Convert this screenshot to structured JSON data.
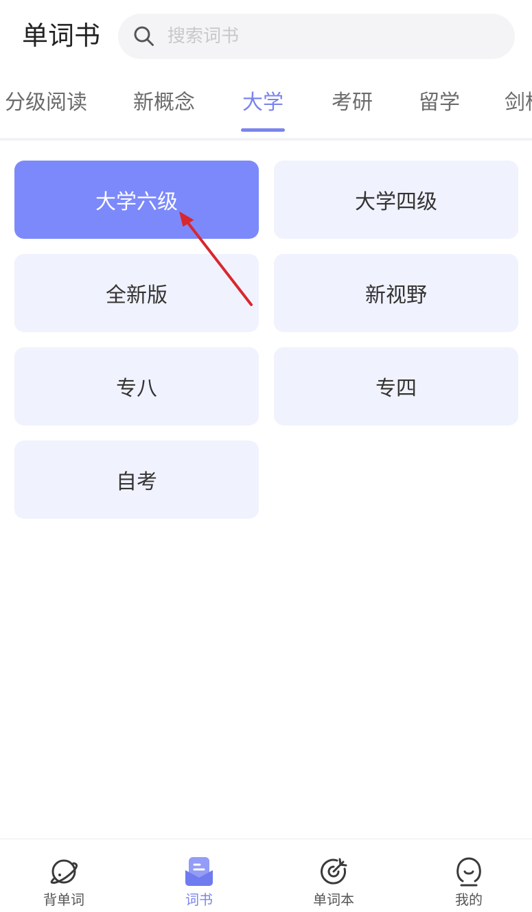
{
  "header": {
    "title": "单词书",
    "search": {
      "placeholder": "搜索词书",
      "icon": "search-icon"
    }
  },
  "tabs": [
    {
      "label": "分级阅读",
      "active": false
    },
    {
      "label": "新概念",
      "active": false
    },
    {
      "label": "大学",
      "active": true
    },
    {
      "label": "考研",
      "active": false
    },
    {
      "label": "留学",
      "active": false
    },
    {
      "label": "剑桥",
      "active": false
    }
  ],
  "books": [
    {
      "label": "大学六级",
      "selected": true
    },
    {
      "label": "大学四级",
      "selected": false
    },
    {
      "label": "全新版",
      "selected": false
    },
    {
      "label": "新视野",
      "selected": false
    },
    {
      "label": "专八",
      "selected": false
    },
    {
      "label": "专四",
      "selected": false
    },
    {
      "label": "自考",
      "selected": false
    }
  ],
  "bottom_nav": [
    {
      "label": "背单词",
      "icon": "planet-icon",
      "active": false
    },
    {
      "label": "词书",
      "icon": "book-icon",
      "active": true
    },
    {
      "label": "单词本",
      "icon": "target-icon",
      "active": false
    },
    {
      "label": "我的",
      "icon": "profile-icon",
      "active": false
    }
  ],
  "colors": {
    "accent": "#7a84ee",
    "selected_card": "#7c89fb",
    "card_background": "#f0f2fd",
    "annotation_arrow": "#d8272e"
  }
}
